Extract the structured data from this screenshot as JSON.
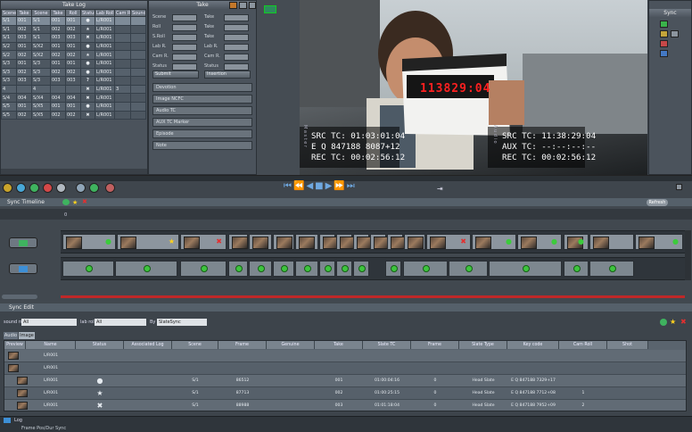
{
  "take_log": {
    "title": "Take Log",
    "columns": [
      "Scene",
      "Take",
      "Scene",
      "Take",
      "Roll",
      "Status",
      "Lab Roll",
      "Cam Roll",
      "Sound"
    ],
    "rows": [
      {
        "scene": "S/1",
        "take": "001",
        "s2": "S/1",
        "t2": "001",
        "roll": "001",
        "status": "ok",
        "lab": "L/R001",
        "cam": "",
        "snd": ""
      },
      {
        "scene": "S/1",
        "take": "002",
        "s2": "S/1",
        "t2": "002",
        "roll": "002",
        "status": "star",
        "lab": "L/R001",
        "cam": "",
        "snd": ""
      },
      {
        "scene": "S/1",
        "take": "003",
        "s2": "S/1",
        "t2": "003",
        "roll": "003",
        "status": "x",
        "lab": "L/R001",
        "cam": "",
        "snd": ""
      },
      {
        "scene": "S/2",
        "take": "001",
        "s2": "S/X2",
        "t2": "001",
        "roll": "001",
        "status": "ok",
        "lab": "L/R001",
        "cam": "",
        "snd": ""
      },
      {
        "scene": "S/2",
        "take": "002",
        "s2": "S/X2",
        "t2": "002",
        "roll": "002",
        "status": "star",
        "lab": "L/R001",
        "cam": "",
        "snd": ""
      },
      {
        "scene": "S/3",
        "take": "001",
        "s2": "S/3",
        "t2": "001",
        "roll": "001",
        "status": "ok",
        "lab": "L/R001",
        "cam": "",
        "snd": ""
      },
      {
        "scene": "S/3",
        "take": "002",
        "s2": "S/3",
        "t2": "002",
        "roll": "002",
        "status": "ok",
        "lab": "L/R001",
        "cam": "",
        "snd": ""
      },
      {
        "scene": "S/3",
        "take": "003",
        "s2": "S/3",
        "t2": "003",
        "roll": "003",
        "status": "q",
        "lab": "L/R001",
        "cam": "",
        "snd": ""
      },
      {
        "scene": "4",
        "take": "",
        "s2": "4",
        "t2": "",
        "roll": "",
        "status": "x",
        "lab": "L/R001",
        "cam": "3",
        "snd": ""
      },
      {
        "scene": "S/4",
        "take": "004",
        "s2": "S/X4",
        "t2": "004",
        "roll": "004",
        "status": "x",
        "lab": "L/R001",
        "cam": "",
        "snd": ""
      },
      {
        "scene": "S/5",
        "take": "001",
        "s2": "S/X5",
        "t2": "001",
        "roll": "001",
        "status": "ok",
        "lab": "L/R001",
        "cam": "",
        "snd": ""
      },
      {
        "scene": "S/5",
        "take": "002",
        "s2": "S/X5",
        "t2": "002",
        "roll": "002",
        "status": "x",
        "lab": "L/R001",
        "cam": "",
        "snd": ""
      }
    ]
  },
  "take_form": {
    "title": "Take",
    "fields_left": [
      "Scene",
      "Roll",
      "S.Roll",
      "Lab R.",
      "Cam R.",
      "Status"
    ],
    "fields_right": [
      "Take",
      "Take",
      "Take",
      "Lab R.",
      "Cam R.",
      "Status"
    ],
    "buttons": [
      "Submit",
      "Insertion"
    ],
    "bars": [
      "Devotion",
      "Image NCFC",
      "Audio TC",
      "AUX TC Marker",
      "Episode",
      "Note"
    ]
  },
  "video": {
    "src_tc_left": "SRC TC: 01:03:01:04",
    "eq_left": "E Q 847188 8087+12",
    "rec_tc_left": "REC TC: 00:02:56:12",
    "src_tc_right": "SRC TC: 11:38:29:04",
    "aux_tc_right": "AUX TC: --:--:--:--",
    "rec_tc_right": "REC TC: 00:02:56:12",
    "slate_display": "113829:04",
    "side_label_left": "M a s t e r",
    "side_label_right": "A u d i o"
  },
  "sync_panel": {
    "title": "Sync"
  },
  "timeline": {
    "title": "Sync Timeline",
    "button": "Refresh",
    "ruler_start": "0",
    "ruler_end": "0418"
  },
  "sync_edit": {
    "title": "Sync Edit",
    "sound_roll_label": "sound roll",
    "sound_roll_value": "All",
    "lab_roll_label": "lab roll",
    "lab_roll_value": "All",
    "by_label": "By",
    "by_value": "SlateSync",
    "tabs": [
      "Audio",
      "Image"
    ],
    "columns": [
      "Preview",
      "Name",
      "Status",
      "Associated Log",
      "Scene",
      "Frame",
      "Genuine",
      "Take",
      "Slate TC",
      "Frame",
      "Slate Type",
      "Key code",
      "Cam Roll",
      "Shot"
    ],
    "rows": [
      {
        "name": "L/R001",
        "status": "",
        "assoc": "",
        "scene": "",
        "frame": "",
        "genuine": "",
        "take": "",
        "slate_tc": "",
        "frame2": "",
        "slate_type": "",
        "keycode": "",
        "cam_roll": "",
        "shot": ""
      },
      {
        "name": "L/R001",
        "status": "",
        "assoc": "",
        "scene": "",
        "frame": "",
        "genuine": "",
        "take": "",
        "slate_tc": "",
        "frame2": "",
        "slate_type": "",
        "keycode": "",
        "cam_roll": "",
        "shot": ""
      },
      {
        "name": "L/R001",
        "status": "ok",
        "assoc": "",
        "scene": "S/1",
        "frame": "86512",
        "genuine": "",
        "take": "001",
        "slate_tc": "01:00:04:16",
        "frame2": "0",
        "slate_type": "Head Slate",
        "keycode": "E Q 847188 7329+17",
        "cam_roll": "",
        "shot": ""
      },
      {
        "name": "L/R001",
        "status": "star",
        "assoc": "",
        "scene": "S/1",
        "frame": "87713",
        "genuine": "",
        "take": "002",
        "slate_tc": "01:00:25:15",
        "frame2": "0",
        "slate_type": "Head Slate",
        "keycode": "E Q 847188 7712+08",
        "cam_roll": "1",
        "shot": ""
      },
      {
        "name": "L/R001",
        "status": "x",
        "assoc": "",
        "scene": "S/1",
        "frame": "88988",
        "genuine": "",
        "take": "003",
        "slate_tc": "01:01:18:04",
        "frame2": "0",
        "slate_type": "Head Slate",
        "keycode": "E Q 847188 7952+09",
        "cam_roll": "2",
        "shot": ""
      }
    ]
  },
  "log_tab": "Log",
  "status_bar": "Frame  Pos/Dur  Sync",
  "colors": {
    "ok": "#3ccb3c",
    "x": "#e23030",
    "star": "#ffd21e",
    "playhead": "#e03030",
    "accent": "#3d8fd6"
  }
}
